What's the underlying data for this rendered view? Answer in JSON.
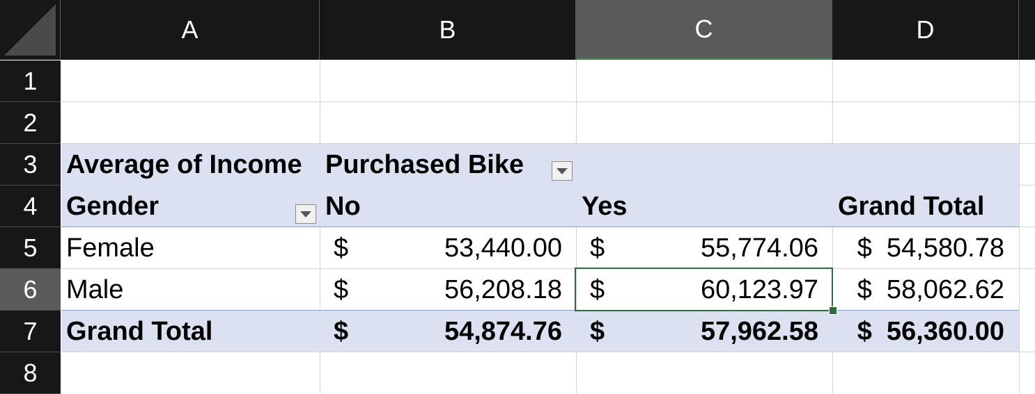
{
  "columns": [
    "A",
    "B",
    "C",
    "D"
  ],
  "rows": [
    "1",
    "2",
    "3",
    "4",
    "5",
    "6",
    "7",
    "8"
  ],
  "pivot": {
    "value_field": "Average of Income",
    "column_field": "Purchased Bike",
    "row_field": "Gender",
    "col_headers": [
      "No",
      "Yes",
      "Grand Total"
    ],
    "data_rows": [
      {
        "label": "Female",
        "no_cur": "$",
        "no": "53,440.00",
        "yes_cur": "$",
        "yes": "55,774.06",
        "gt": "$  54,580.78"
      },
      {
        "label": "Male",
        "no_cur": "$",
        "no": "56,208.18",
        "yes_cur": "$",
        "yes": "60,123.97",
        "gt": "$  58,062.62"
      }
    ],
    "total_row": {
      "label": "Grand Total",
      "no_cur": "$",
      "no": "54,874.76",
      "yes_cur": "$",
      "yes": "57,962.58",
      "gt": "$  56,360.00"
    }
  },
  "selection": {
    "active_cell": "C6",
    "selected_column": "C",
    "selected_row": "6"
  },
  "colors": {
    "header_bg": "#171717",
    "selected_header_bg": "#5a5a5a",
    "pivot_band": "#dce1f1",
    "selection_border": "#2f6b3e"
  }
}
